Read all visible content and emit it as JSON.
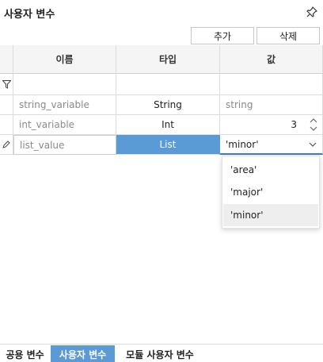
{
  "panel": {
    "title": "사용자 변수",
    "pin_icon": "pin-icon"
  },
  "toolbar": {
    "add_label": "추가",
    "delete_label": "삭제"
  },
  "grid": {
    "columns": [
      "이름",
      "타입",
      "값"
    ],
    "filter_icon": "filter-icon",
    "rows": [
      {
        "name": "string_variable",
        "type": "String",
        "value": "string"
      },
      {
        "name": "int_variable",
        "type": "Int",
        "value": "3"
      },
      {
        "name": "list_value",
        "type": "List",
        "value": "'minor'"
      }
    ],
    "editing_row_icon": "pencil-icon"
  },
  "dropdown": {
    "options": [
      "'area'",
      "'major'",
      "'minor'"
    ],
    "selected": "'minor'"
  },
  "tabs": {
    "common": "공용 변수",
    "user": "사용자 변수",
    "module_user": "모듈 사용자 변수"
  },
  "colors": {
    "accent": "#5b9bd5",
    "editor_underline": "#3a7bd5"
  }
}
